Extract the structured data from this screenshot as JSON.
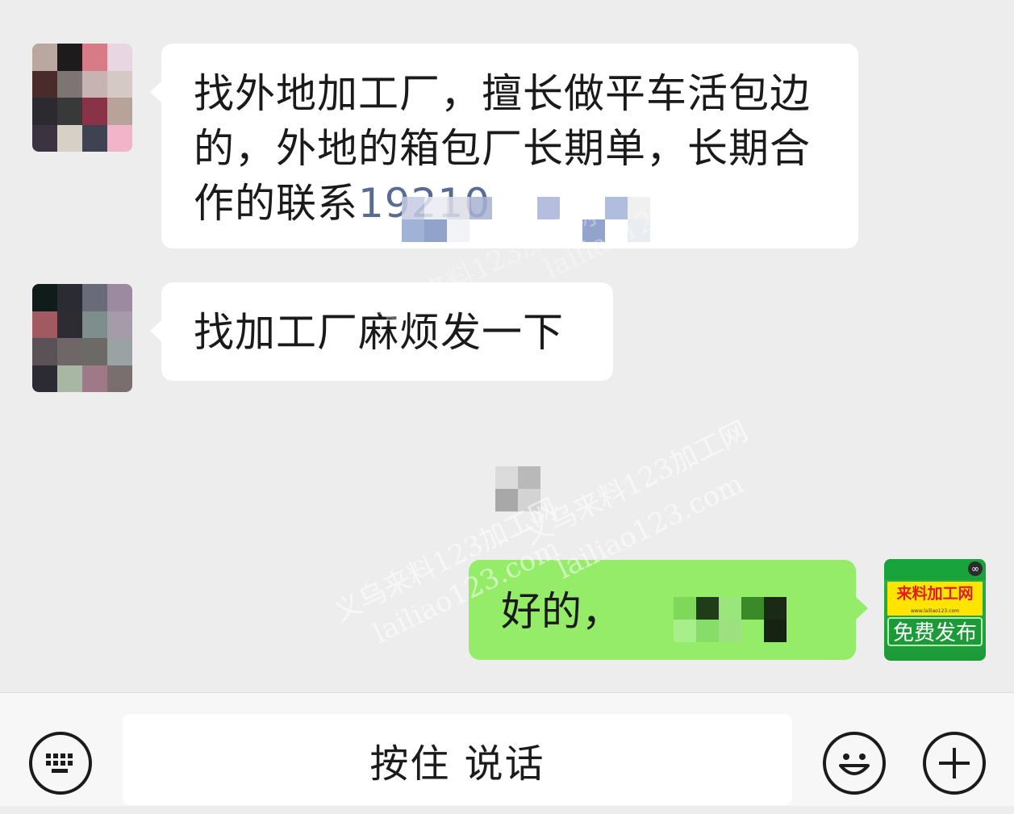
{
  "chat": {
    "messages": [
      {
        "direction": "received",
        "text": "找外地加工厂，擅长做平车活包边的，外地的箱包厂长期单，长期合作的联系",
        "phone": "19210"
      },
      {
        "direction": "received",
        "text": "找加工厂麻烦发一下"
      },
      {
        "direction": "sent",
        "text": "好的，"
      }
    ],
    "self_avatar": {
      "brand": "来料加工网",
      "url": "www.lailiao123.com",
      "cta": "免费发布"
    }
  },
  "watermarks": [
    "义乌来料123加工网",
    "lailiao123.com"
  ],
  "input_bar": {
    "hold_to_talk_label": "按住 说话"
  },
  "colors": {
    "chat_background": "#ededed",
    "received_bubble": "#ffffff",
    "sent_bubble": "#95ec69",
    "phone_link": "#576b95"
  },
  "icons": {
    "left": "keyboard-icon",
    "right_1": "emoji-icon",
    "right_2": "plus-icon"
  }
}
